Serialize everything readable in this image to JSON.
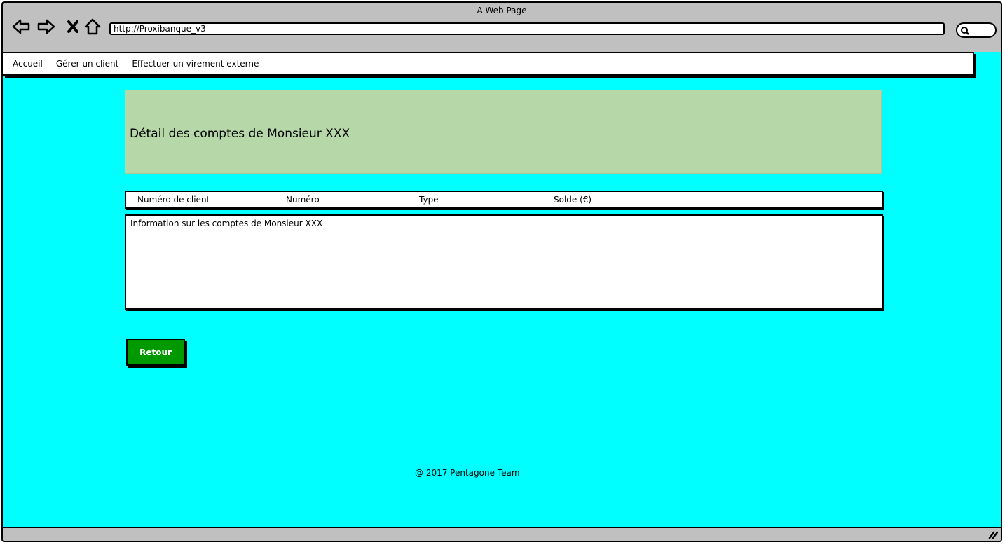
{
  "browser": {
    "title": "A Web Page",
    "url": "http://Proxibanque_v3",
    "icons": [
      "back-arrow-icon",
      "forward-arrow-icon",
      "close-icon",
      "home-icon",
      "search-icon",
      "resize-grip-icon"
    ]
  },
  "nav": {
    "items": [
      {
        "label": "Accueil"
      },
      {
        "label": "Gérer un client"
      },
      {
        "label": "Effectuer un virement externe"
      }
    ]
  },
  "page": {
    "heading": "Détail des comptes de Monsieur XXX",
    "table": {
      "columns": [
        "Numéro de client",
        "Numéro",
        "Type",
        "Solde (€)"
      ]
    },
    "info_text": "Information sur les comptes de Monsieur XXX",
    "back_button": "Retour",
    "footer": "@ 2017 Pentagone Team"
  },
  "colors": {
    "background": "#00ffff",
    "header_box": "#b6d7a8",
    "button": "#009900",
    "chrome": "#c0c0c0"
  }
}
